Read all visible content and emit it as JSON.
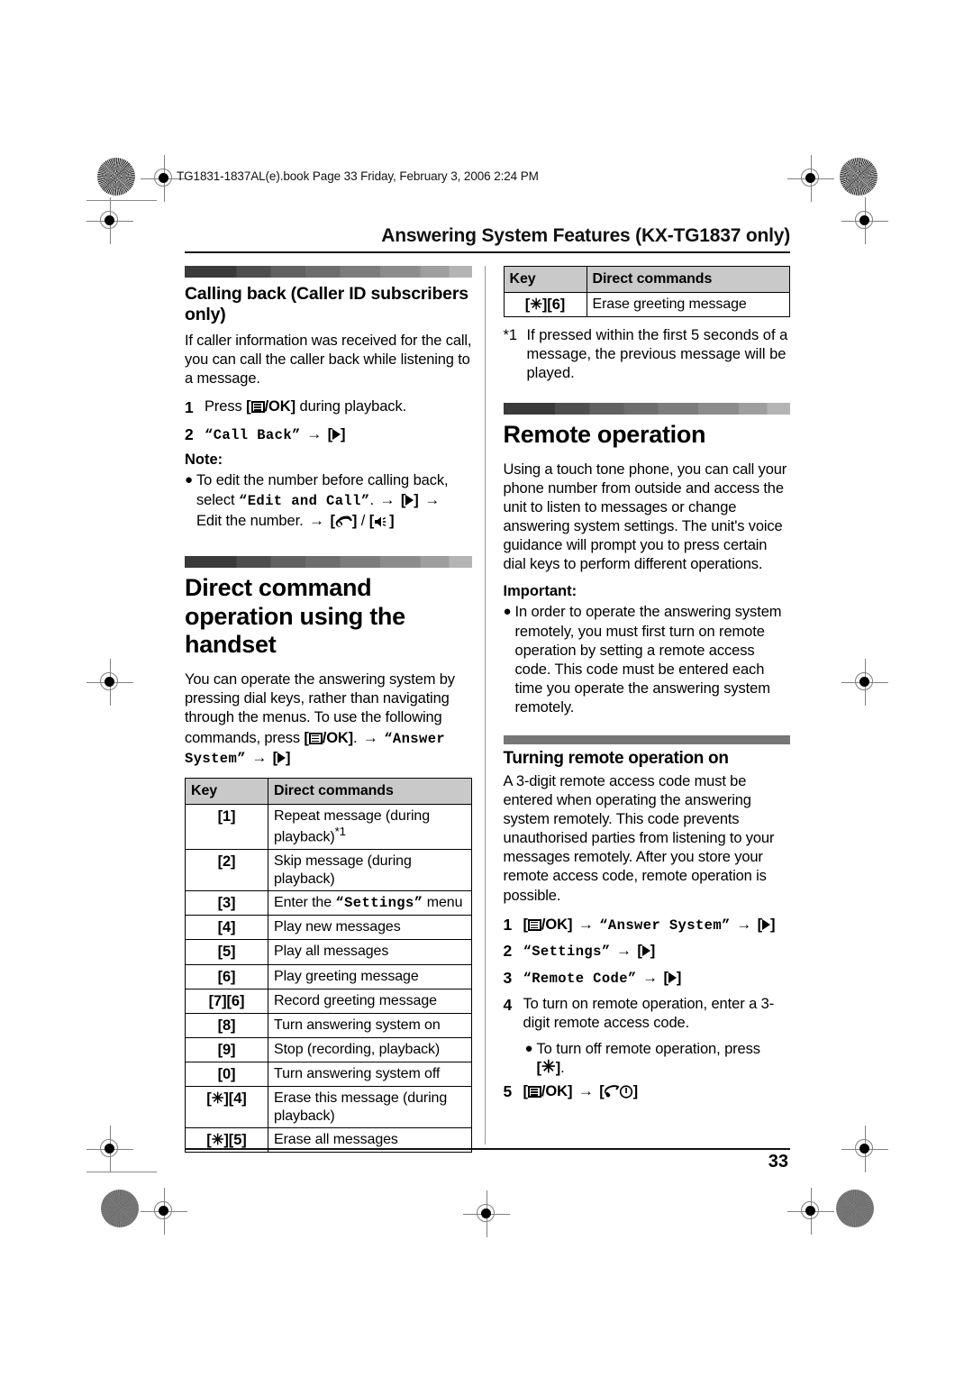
{
  "slug": "TG1831-1837AL(e).book  Page 33  Friday, February 3, 2006  2:24 PM",
  "running_head": "Answering System Features (KX-TG1837 only)",
  "page_number": "33",
  "left_column": {
    "section1": {
      "heading": "Calling back (Caller ID subscribers only)",
      "intro": "If caller information was received for the call, you can call the caller back while listening to a message.",
      "steps": [
        {
          "num": "1",
          "pre": "Press ",
          "key": "[≡/OK]",
          "post": " during playback."
        },
        {
          "num": "2",
          "lcd": "“Call Back”",
          "arrow": "→",
          "key": "[▶]"
        }
      ],
      "note_label": "Note:",
      "note_bullet": {
        "line1": "To edit the number before calling back,",
        "line2_pre": "select ",
        "line2_lcd": "“Edit and Call”",
        "line2_post": ".",
        "line3": "Edit the number."
      }
    },
    "section2": {
      "heading": "Direct command operation using the handset",
      "intro_pre": "You can operate the answering system by pressing dial keys, rather than navigating through the menus. To use the following commands, press ",
      "intro_key": "[≡/OK]",
      "intro_mid": ".",
      "intro_lcd": "“Answer System”",
      "intro_key2": "[▶]",
      "table": {
        "headers": [
          "Key",
          "Direct commands"
        ],
        "rows": [
          {
            "key": "[1]",
            "command": "Repeat message (during playback)",
            "footnote": "*1"
          },
          {
            "key": "[2]",
            "command": "Skip message (during playback)"
          },
          {
            "key": "[3]",
            "command_pre": "Enter the ",
            "command_lcd": "“Settings”",
            "command_post": " menu"
          },
          {
            "key": "[4]",
            "command": "Play new messages"
          },
          {
            "key": "[5]",
            "command": "Play all messages"
          },
          {
            "key": "[6]",
            "command": "Play greeting message"
          },
          {
            "key": "[7][6]",
            "command": "Record greeting message"
          },
          {
            "key": "[8]",
            "command": "Turn answering system on"
          },
          {
            "key": "[9]",
            "command": "Stop (recording, playback)"
          },
          {
            "key": "[0]",
            "command": "Turn answering system off"
          },
          {
            "key": "[✳][4]",
            "command": "Erase this message (during playback)"
          },
          {
            "key": "[✳][5]",
            "command": "Erase all messages"
          }
        ]
      }
    }
  },
  "right_column": {
    "table_continued": {
      "headers": [
        "Key",
        "Direct commands"
      ],
      "rows": [
        {
          "key": "[✳][6]",
          "command": "Erase greeting message"
        }
      ]
    },
    "footnote": {
      "mark": "*1",
      "text": "If pressed within the first 5 seconds of a message, the previous message will be played."
    },
    "section_remote": {
      "heading": "Remote operation",
      "intro": "Using a touch tone phone, you can call your phone number from outside and access the unit to listen to messages or change answering system settings. The unit's voice guidance will prompt you to press certain dial keys to perform different operations.",
      "important_label": "Important:",
      "important_bullet": "In order to operate the answering system remotely, you must first turn on remote operation by setting a remote access code. This code must be entered each time you operate the answering system remotely."
    },
    "section_turning_on": {
      "heading": "Turning remote operation on",
      "intro": "A 3-digit remote access code must be entered when operating the answering system remotely. This code prevents unauthorised parties from listening to your messages remotely. After you store your remote access code, remote operation is possible.",
      "steps": [
        {
          "num": "1",
          "key1": "[≡/OK]",
          "lcd": "“Answer System”",
          "key2": "[▶]"
        },
        {
          "num": "2",
          "lcd": "“Settings”",
          "key2": "[▶]"
        },
        {
          "num": "3",
          "lcd": "“Remote Code”",
          "key2": "[▶]"
        },
        {
          "num": "4",
          "text": "To turn on remote operation, enter a 3-digit remote access code."
        },
        {
          "num": "5",
          "key1": "[≡/OK]",
          "key2": "[✕ⓞ]"
        }
      ],
      "step4_bullet_pre": "To turn off remote operation, press",
      "step4_bullet_key": "[✳]",
      "step4_bullet_post": "."
    }
  },
  "colors": {
    "table_header_bg": "#c9c9c9",
    "rule": "#111111",
    "subsection_bar": "#767676"
  }
}
